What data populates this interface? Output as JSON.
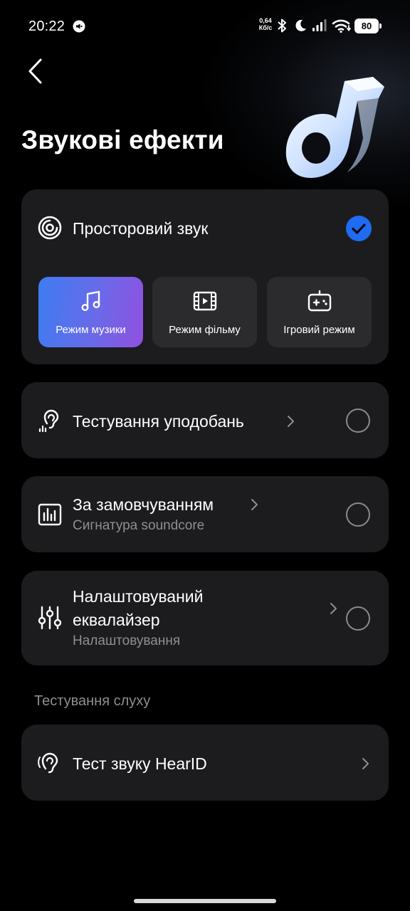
{
  "status_bar": {
    "time": "20:22",
    "net_speed_value": "0,64",
    "net_speed_unit": "Кб/с",
    "battery": "80",
    "icons": [
      "notification-icon",
      "bluetooth-icon",
      "moon-icon",
      "signal-icon",
      "wifi-icon",
      "battery-icon"
    ]
  },
  "header": {
    "title": "Звукові ефекти",
    "back_icon": "back-arrow-icon",
    "hero_icon": "soundcore-note-logo"
  },
  "spatial": {
    "title": "Просторовий звук",
    "selected": true,
    "modes": [
      {
        "label": "Режим музики",
        "icon": "music-note-icon",
        "active": true
      },
      {
        "label": "Режим фільму",
        "icon": "film-icon",
        "active": false
      },
      {
        "label": "Ігровий режим",
        "icon": "gamepad-icon",
        "active": false
      }
    ]
  },
  "options": [
    {
      "title": "Тестування уподобань",
      "icon": "ear-preference-icon",
      "selected": false
    },
    {
      "title": "За замовчуванням",
      "subtitle": "Сигнатура soundcore",
      "icon": "equalizer-bars-icon",
      "selected": false
    },
    {
      "title_line1": "Налаштовуваний",
      "title_line2": "еквалайзер",
      "subtitle": "Налаштовування",
      "icon": "sliders-icon",
      "selected": false
    }
  ],
  "hearing_section": {
    "label": "Тестування слуху",
    "item": {
      "title": "Тест звуку HearID",
      "icon": "hearid-ear-icon"
    }
  },
  "colors": {
    "background": "#000000",
    "card": "#1c1c1e",
    "accent_blue": "#1f6bf2",
    "secondary_text": "#8e8e93"
  }
}
